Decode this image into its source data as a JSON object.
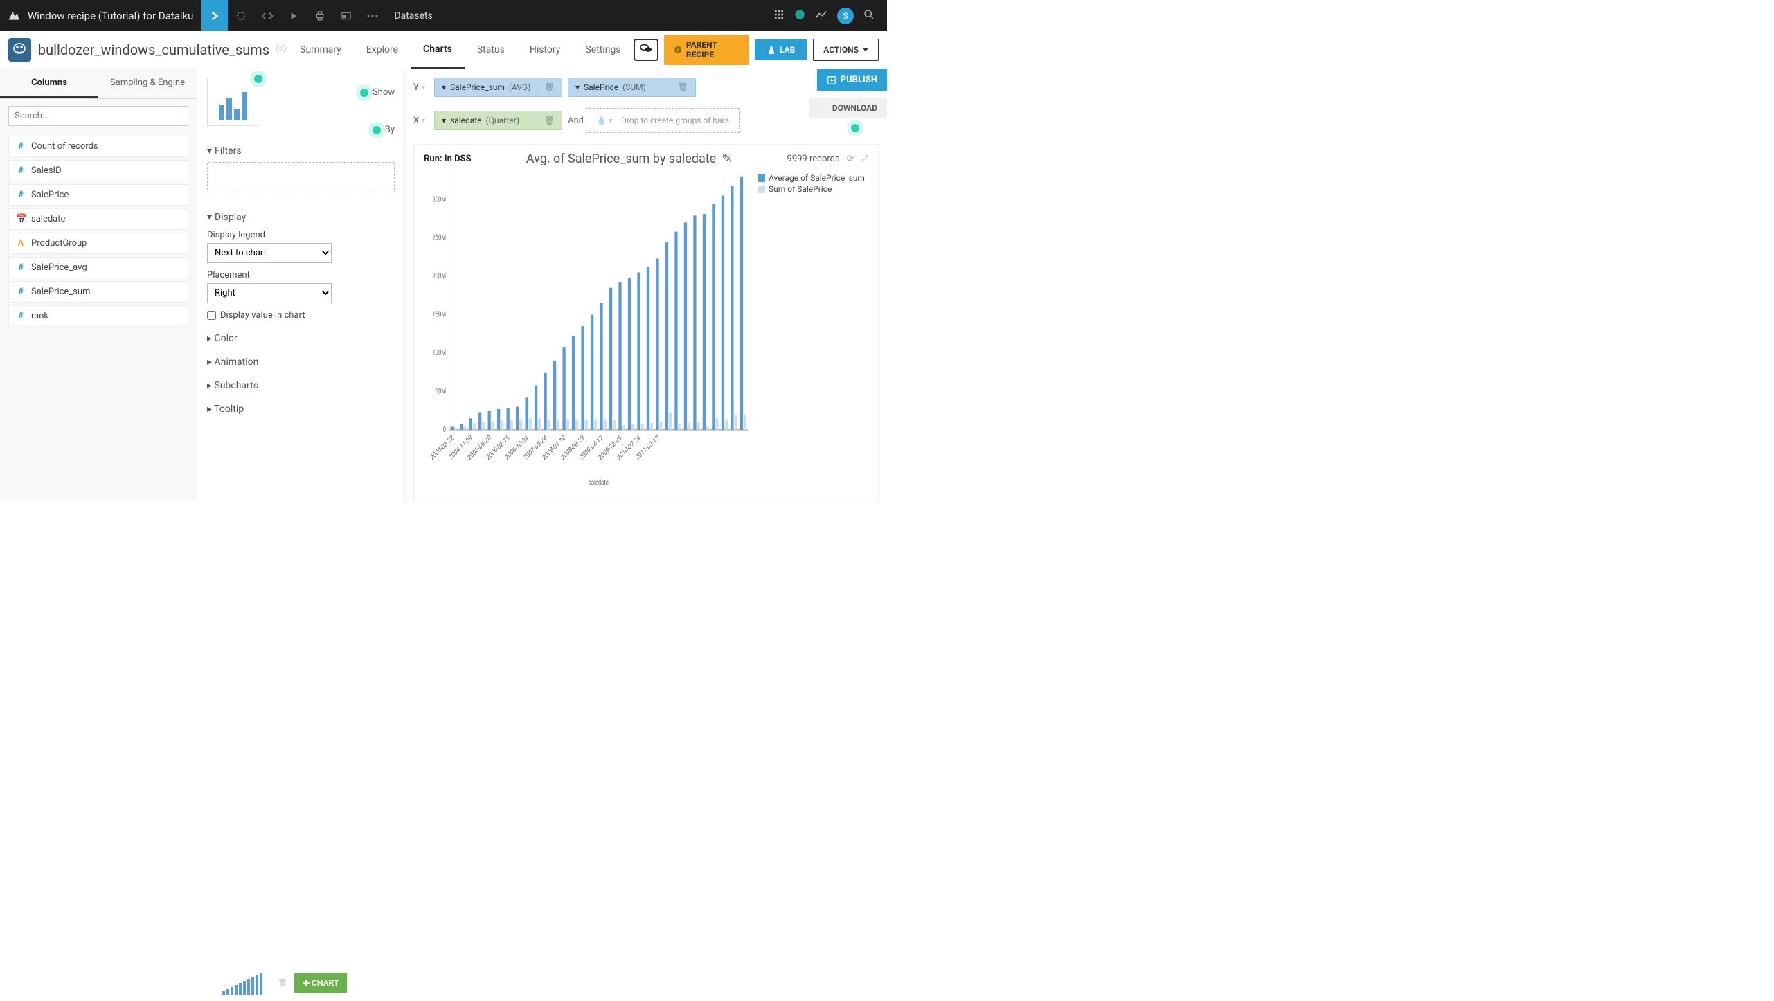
{
  "topbar": {
    "title": "Window recipe (Tutorial) for Dataiku",
    "tab": "Datasets",
    "avatar": "S"
  },
  "subbar": {
    "name": "bulldozer_windows_cumulative_sums",
    "nav": [
      "Summary",
      "Explore",
      "Charts",
      "Status",
      "History",
      "Settings"
    ],
    "active": "Charts",
    "parent": "PARENT RECIPE",
    "lab": "LAB",
    "actions": "ACTIONS"
  },
  "sidebar": {
    "tabs": [
      "Columns",
      "Sampling & Engine"
    ],
    "active": "Columns",
    "search_ph": "Search…",
    "columns": [
      {
        "icon": "#",
        "type": "num",
        "name": "Count of records"
      },
      {
        "icon": "#",
        "type": "num",
        "name": "SalesID"
      },
      {
        "icon": "#",
        "type": "num",
        "name": "SalePrice"
      },
      {
        "icon": "📅",
        "type": "date",
        "name": "saledate"
      },
      {
        "icon": "A",
        "type": "text",
        "name": "ProductGroup"
      },
      {
        "icon": "#",
        "type": "num",
        "name": "SalePrice_avg"
      },
      {
        "icon": "#",
        "type": "num",
        "name": "SalePrice_sum"
      },
      {
        "icon": "#",
        "type": "num",
        "name": "rank"
      }
    ]
  },
  "center": {
    "filters": "Filters",
    "display": "Display",
    "display_legend": "Display legend",
    "legend_val": "Next to chart",
    "placement": "Placement",
    "placement_val": "Right",
    "value_chk": "Display value in chart",
    "color": "Color",
    "animation": "Animation",
    "subcharts": "Subcharts",
    "tooltip": "Tooltip",
    "show": "Show",
    "by": "By"
  },
  "config": {
    "y": {
      "field": "SalePrice_sum",
      "agg": "(AVG)"
    },
    "y2": {
      "field": "SalePrice",
      "agg": "(SUM)"
    },
    "x": {
      "field": "saledate",
      "agg": "(Quarter)"
    },
    "and": "And",
    "and_ph": "Drop to create groups of bars",
    "publish": "PUBLISH",
    "download": "DOWNLOAD"
  },
  "chart": {
    "run": "Run: In DSS",
    "title": "Avg. of SalePrice_sum by saledate",
    "records": "9999 records",
    "legend": [
      "Average of SalePrice_sum",
      "Sum of SalePrice"
    ]
  },
  "bottom": {
    "chart": "CHART"
  },
  "chart_data": {
    "type": "bar",
    "title": "Avg. of SalePrice_sum by saledate",
    "xlabel": "saledate",
    "ylabel": "",
    "ylim": [
      0,
      330000000
    ],
    "yticks": [
      0,
      50000000,
      100000000,
      150000000,
      200000000,
      250000000,
      300000000
    ],
    "ytick_labels": [
      "0",
      "50M",
      "100M",
      "150M",
      "200M",
      "250M",
      "300M"
    ],
    "categories": [
      "2004-03-22",
      "",
      "2004-11-09",
      "",
      "2005-06-28",
      "",
      "2006-02-15",
      "",
      "2006-10-04",
      "",
      "2007-05-24",
      "",
      "2008-01-10",
      "",
      "2008-08-29",
      "",
      "2009-04-17",
      "",
      "2009-12-05",
      "",
      "2010-07-24",
      "",
      "2011-03-13",
      ""
    ],
    "xticks": [
      "2004-03-22",
      "2004-11-09",
      "2005-06-28",
      "2006-02-15",
      "2006-10-04",
      "2007-05-24",
      "2008-01-10",
      "2008-08-29",
      "2009-04-17",
      "2009-12-05",
      "2010-07-24",
      "2011-03-13"
    ],
    "series": [
      {
        "name": "Average of SalePrice_sum",
        "color": "#5a9bd4",
        "values": [
          4,
          8,
          15,
          23,
          25,
          27,
          28,
          30,
          42,
          58,
          74,
          90,
          108,
          122,
          135,
          150,
          165,
          185,
          192,
          198,
          205,
          212,
          223,
          244,
          258,
          270,
          279,
          281,
          294,
          305,
          318,
          330
        ]
      },
      {
        "name": "Sum of SalePrice",
        "color": "#cdddef",
        "values": [
          3,
          5,
          9,
          10,
          11,
          12,
          13,
          14,
          15,
          15,
          14,
          14,
          14,
          14,
          13,
          14,
          14,
          13,
          6,
          7,
          8,
          9,
          10,
          23,
          8,
          9,
          10,
          4,
          15,
          14,
          20,
          20
        ]
      }
    ],
    "value_scale": 1000000
  }
}
